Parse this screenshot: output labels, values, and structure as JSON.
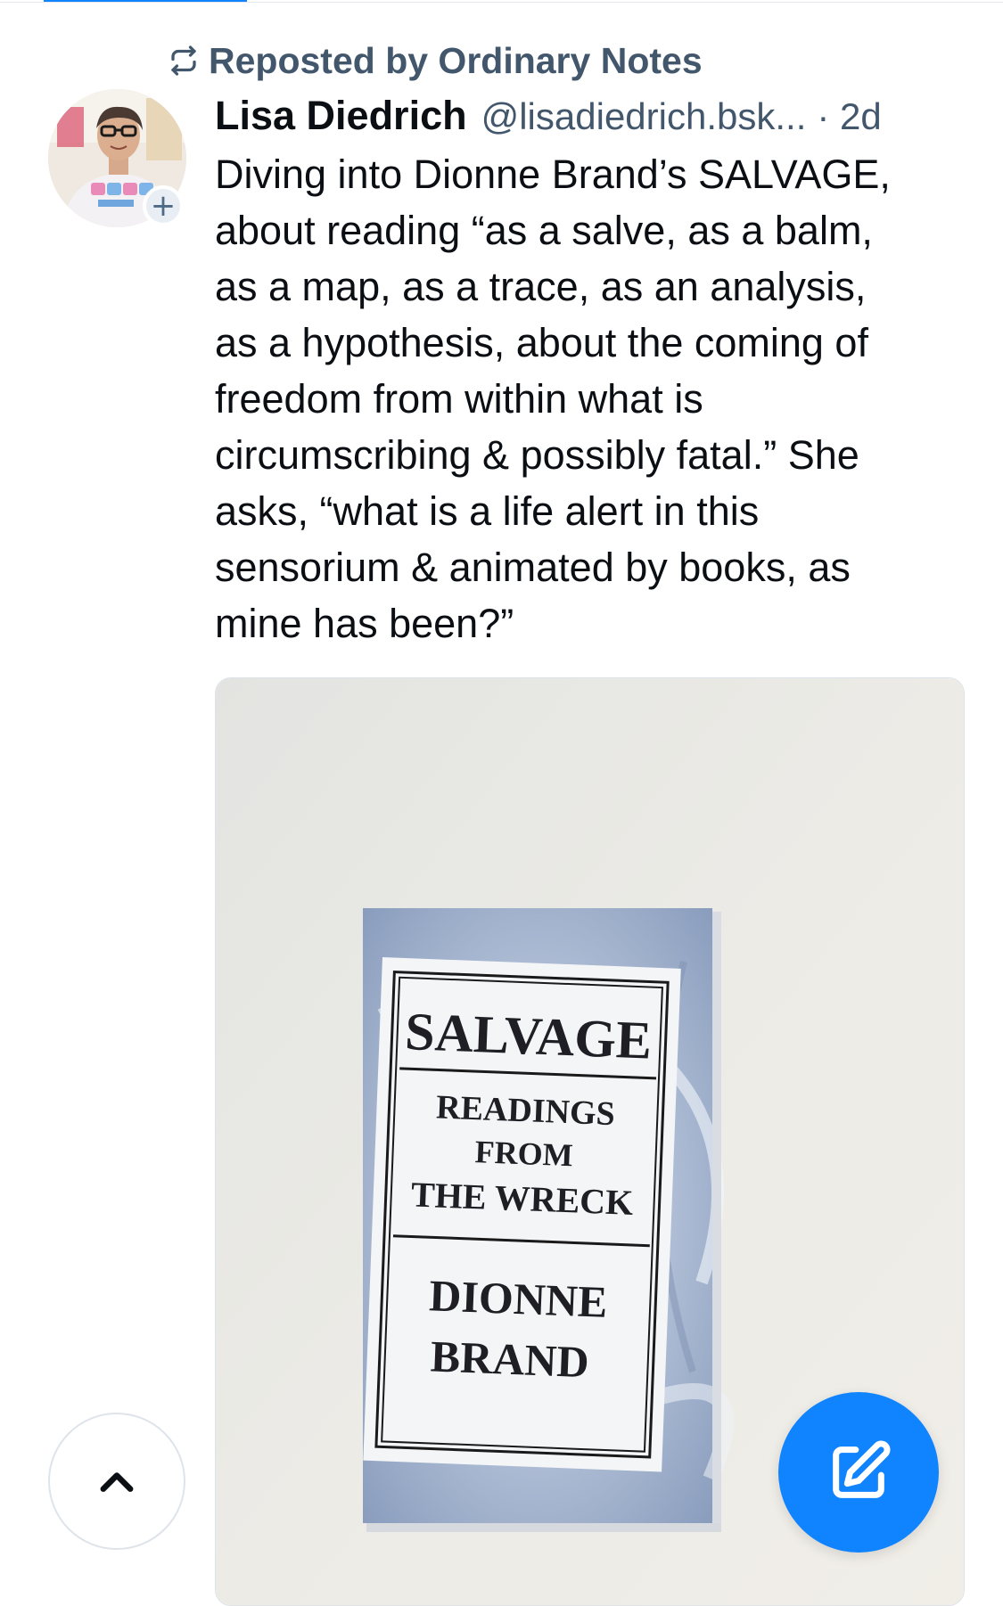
{
  "repost": {
    "icon": "repost-icon",
    "label": "Reposted by Ordinary Notes"
  },
  "post": {
    "author_name": "Lisa Diedrich",
    "author_handle": "@lisadiedrich.bsk...",
    "time": "· 2d",
    "avatar_badge": "+",
    "text_lines": [
      "Diving into Dionne Brand’s SALVAGE,",
      "about reading “as a salve, as a balm,",
      "as a map, as a trace, as an analysis,",
      "as a hypothesis, about the coming of",
      "freedom from within what is",
      "circumscribing & possibly fatal.” She",
      "asks, “what is a life alert in this",
      "sensorium & animated by books, as",
      "mine has been?”"
    ],
    "image": {
      "book_title": "SALVAGE",
      "book_subtitle_1": "READINGS",
      "book_subtitle_2": "FROM",
      "book_subtitle_3": "THE WRECK",
      "book_author_1": "DIONNE",
      "book_author_2": "BRAND"
    }
  },
  "buttons": {
    "scroll_top_icon": "chevron-up-icon",
    "compose_icon": "compose-icon"
  },
  "colors": {
    "accent": "#1083fe",
    "secondary_text": "#42566c"
  }
}
